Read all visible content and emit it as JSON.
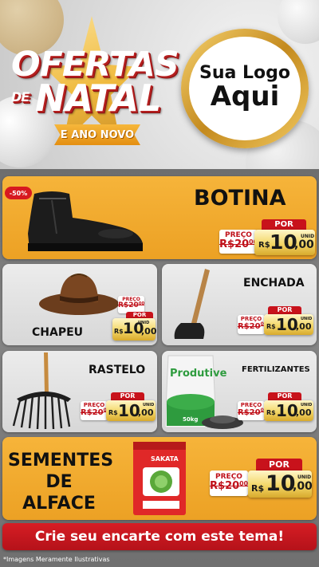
{
  "header": {
    "title_line1": "OFERTAS",
    "title_de": "DE",
    "title_line2": "NATAL",
    "subtitle": "E ANO NOVO",
    "logo_line1": "Sua Logo",
    "logo_line2": "Aqui"
  },
  "badge": "-50%",
  "products": [
    {
      "name": "BOTINA",
      "preco_label": "PREÇO",
      "old_int": "20",
      "old_cents": "00",
      "por_label": "POR",
      "currency": "R$",
      "new_int": "10",
      "new_cents": ",00",
      "unit": "UNID"
    },
    {
      "name": "CHAPEU",
      "preco_label": "PREÇO",
      "old_int": "20",
      "old_cents": "00",
      "por_label": "POR",
      "currency": "R$",
      "new_int": "10",
      "new_cents": ",00",
      "unit": "UNID"
    },
    {
      "name": "ENCHADA",
      "preco_label": "PREÇO",
      "old_int": "20",
      "old_cents": "00",
      "por_label": "POR",
      "currency": "R$",
      "new_int": "10",
      "new_cents": ",00",
      "unit": "UNID"
    },
    {
      "name": "RASTELO",
      "preco_label": "PREÇO",
      "old_int": "20",
      "old_cents": "00",
      "por_label": "POR",
      "currency": "R$",
      "new_int": "10",
      "new_cents": ",00",
      "unit": "UNID"
    },
    {
      "name": "FERTILIZANTES",
      "preco_label": "PREÇO",
      "old_int": "20",
      "old_cents": "00",
      "por_label": "POR",
      "currency": "R$",
      "new_int": "10",
      "new_cents": ",00",
      "unit": "UNID"
    },
    {
      "name_l1": "SEMENTES",
      "name_l2": "DE",
      "name_l3": "ALFACE",
      "preco_label": "PREÇO",
      "old_int": "20",
      "old_cents": "00",
      "por_label": "POR",
      "currency": "R$",
      "new_int": "10",
      "new_cents": ",00",
      "unit": "UNID"
    }
  ],
  "product_images": {
    "fertilizer_brand": "Produtive",
    "fertilizer_weight": "50kg",
    "seed_brand": "SAKATA"
  },
  "cta": "Crie seu encarte com este tema!",
  "footnote": "*Imagens Meramente Ilustrativas",
  "colors": {
    "accent_orange": "#f2ab2e",
    "red": "#c8121b",
    "gold": "#f3d768"
  }
}
